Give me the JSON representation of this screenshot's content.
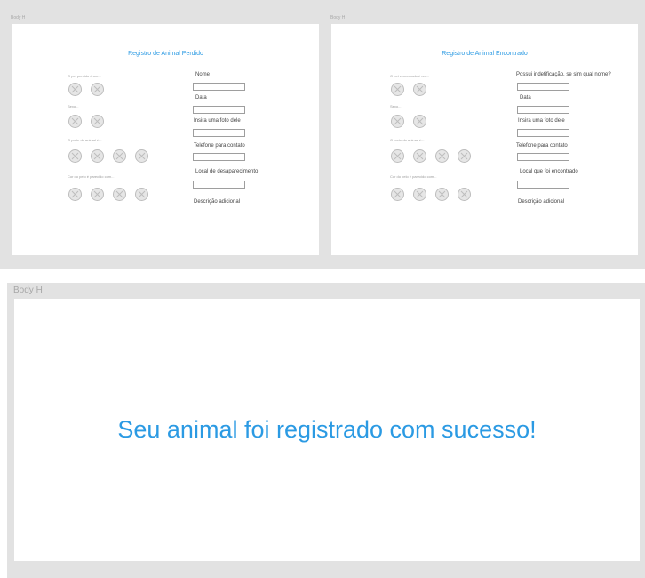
{
  "colors": {
    "accent": "#2b9ae3",
    "frame_bg": "#e2e2e2",
    "canvas_bg": "#ffffff"
  },
  "lost_frame": {
    "frame_label": "Body H",
    "title": "Registro de Animal Perdido",
    "questions": [
      "O pet perdido é um...",
      "Sexo...",
      "O porte do animal é...",
      "Cor do pelo é parecido com..."
    ],
    "fields": [
      "Nome",
      "Data",
      "Insira uma foto dele",
      "Telefone para contato",
      "Local de desaparecimento",
      "Descrição adicional"
    ]
  },
  "found_frame": {
    "frame_label": "Body H",
    "title": "Registro de Animal Encontrado",
    "questions": [
      "O pet encontrado é um...",
      "Sexo...",
      "O porte do animal é...",
      "Cor do pelo é parecido com..."
    ],
    "fields": [
      "Possui indetificação, se sim qual nome?",
      "Data",
      "Insira uma foto dele",
      "Telefone para contato",
      "Local que foi encontrado",
      "Descrição adicional"
    ]
  },
  "success_frame": {
    "frame_label": "Body H",
    "message": "Seu animal foi registrado com sucesso!"
  },
  "icons": {
    "option_circle": "crossed-circle-placeholder-icon"
  }
}
